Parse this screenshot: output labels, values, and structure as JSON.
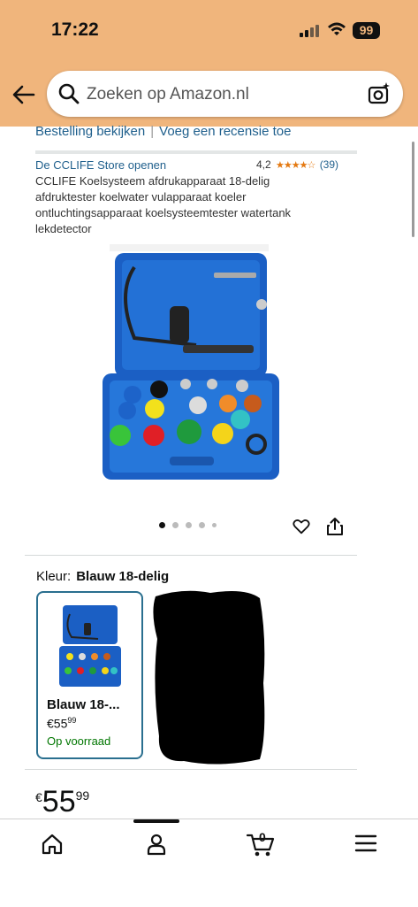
{
  "status": {
    "time": "17:22",
    "battery": "99"
  },
  "search": {
    "placeholder": "Zoeken op Amazon.nl"
  },
  "links": {
    "order": "Bestelling bekijken",
    "review": "Voeg een recensie toe"
  },
  "product": {
    "store": "De CCLIFE Store openen",
    "rating_value": "4,2",
    "rating_stars": 4.2,
    "rating_count": "(39)",
    "title": "CCLIFE Koelsysteem afdrukapparaat 18-delig afdruktester koelwater vulapparaat koeler ontluchtingsapparaat koelsysteemtester watertank lekdetector",
    "image_count": 5,
    "active_image": 1
  },
  "color": {
    "label": "Kleur:",
    "value": "Blauw 18-delig"
  },
  "variant": {
    "name": "Blauw 18-...",
    "price_whole": "€55",
    "price_fraction": "99",
    "stock": "Op voorraad"
  },
  "price": {
    "currency": "€",
    "whole": "55",
    "fraction": "99"
  },
  "nav": {
    "cart_count": "0"
  },
  "colors": {
    "header": "#f0b57c",
    "link": "#1f5f8c",
    "stock": "#007600",
    "star": "#e47911",
    "case_blue": "#1d63c9"
  },
  "icons": [
    "back-arrow-icon",
    "search-icon",
    "camera-icon",
    "heart-icon",
    "share-icon",
    "home-icon",
    "account-icon",
    "cart-icon",
    "menu-icon"
  ]
}
